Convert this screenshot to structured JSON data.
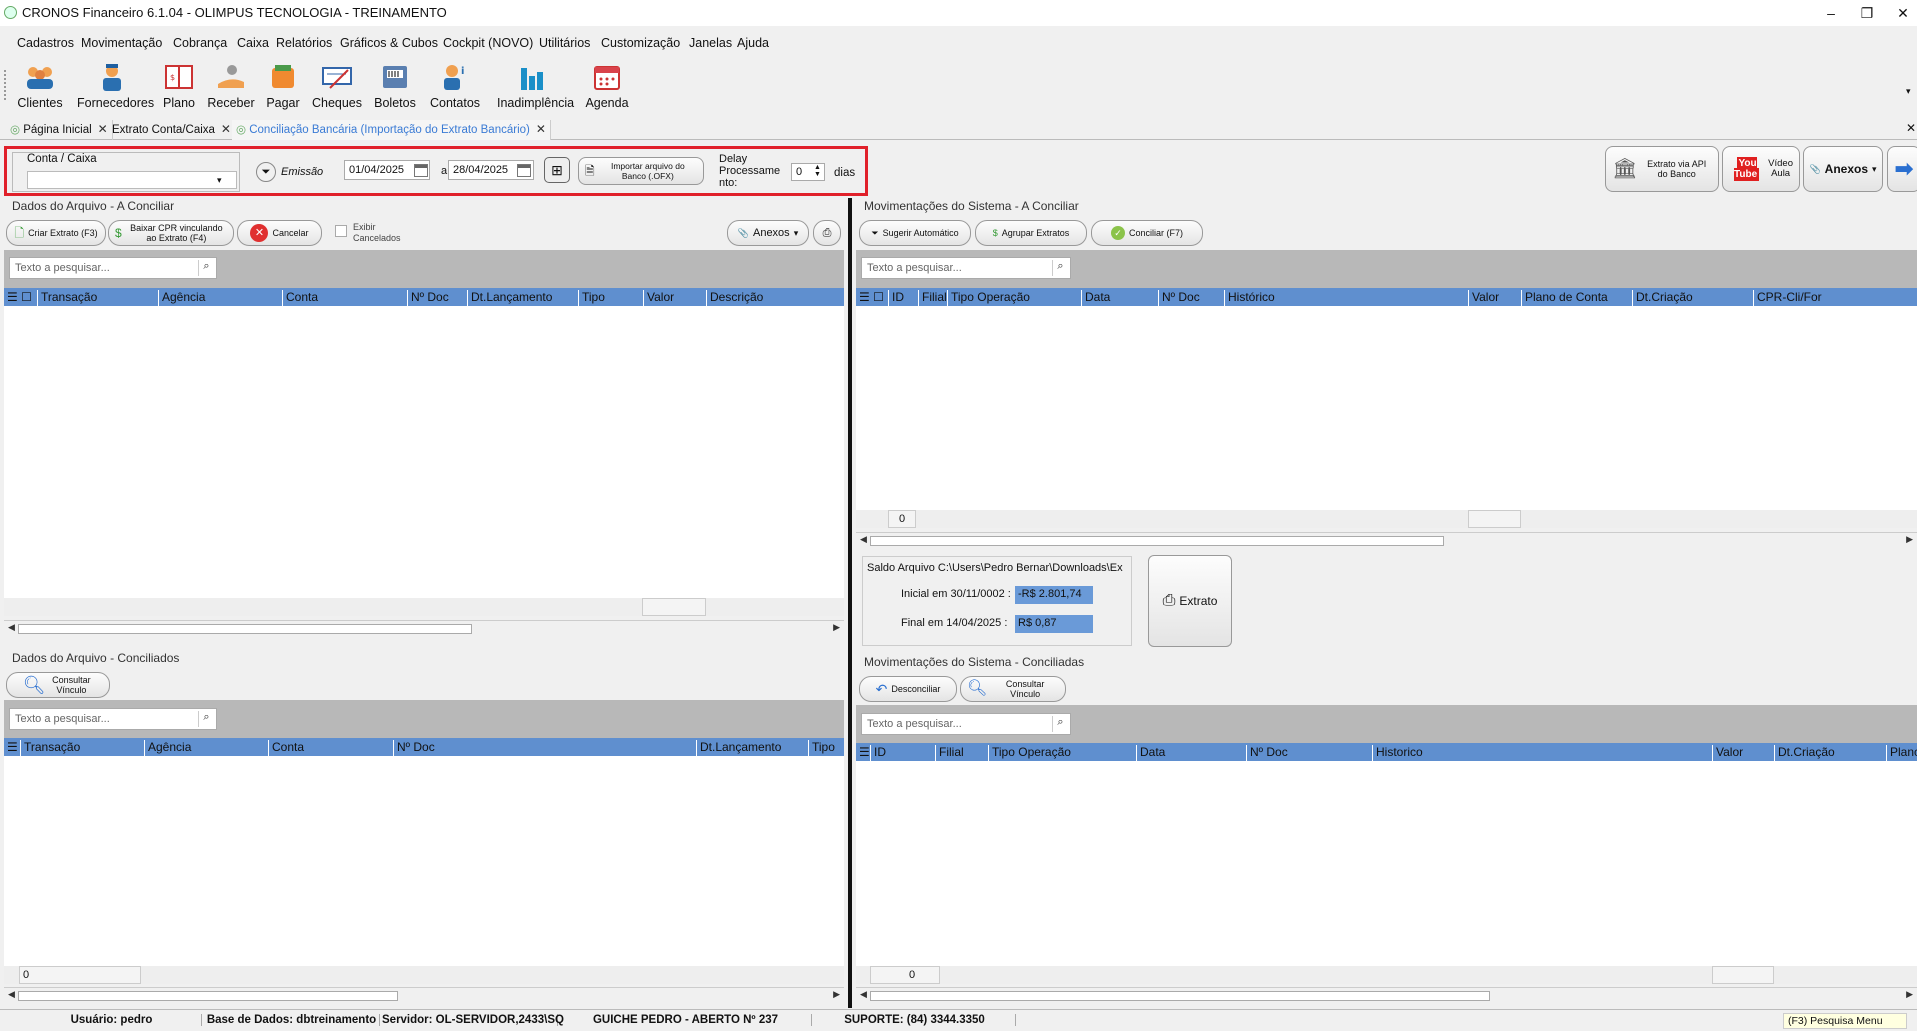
{
  "window": {
    "title": "CRONOS Financeiro 6.1.04 - OLIMPUS TECNOLOGIA - TREINAMENTO",
    "minimize": "‒",
    "restore": "❐",
    "close": "✕"
  },
  "menu": [
    "Cadastros",
    "Movimentação",
    "Cobrança",
    "Caixa",
    "Relatórios",
    "Gráficos & Cubos",
    "Cockpit (NOVO)",
    "Utilitários",
    "Customização",
    "Janelas",
    "Ajuda"
  ],
  "toolbar": [
    "Clientes",
    "Fornecedores",
    "Plano",
    "Receber",
    "Pagar",
    "Cheques",
    "Boletos",
    "Contatos",
    "Inadimplência",
    "Agenda"
  ],
  "tabs": [
    {
      "label": "Página Inicial"
    },
    {
      "label": "Extrato Conta/Caixa"
    },
    {
      "label": "Conciliação Bancária (Importação do Extrato Bancário)"
    }
  ],
  "filters": {
    "conta_label": "Conta / Caixa",
    "conta_value": "",
    "emissao_label": "Emissão",
    "date_from": "01/04/2025",
    "date_sep": "a",
    "date_to": "28/04/2025",
    "import_label": "Importar arquivo do Banco (.OFX)",
    "delay_label": "Delay Processame nto:",
    "delay_value": "0",
    "dias": "dias",
    "api_label": "Extrato via API do Banco",
    "video_label": "Vídeo Aula",
    "youtube": "You Tube",
    "anexos": "Anexos"
  },
  "left_top": {
    "title": "Dados do Arquivo - A Conciliar",
    "btn_criar": "Criar Extrato (F3)",
    "btn_baixar": "Baixar CPR vinculando ao Extrato (F4)",
    "btn_cancelar": "Cancelar",
    "chk_exibir": "Exibir Cancelados",
    "btn_anexos": "Anexos",
    "search_placeholder": "Texto a pesquisar...",
    "columns": [
      "Transação",
      "Agência",
      "Conta",
      "Nº Doc",
      "Dt.Lançamento",
      "Tipo",
      "Valor",
      "Descrição"
    ]
  },
  "left_bottom": {
    "title": "Dados do Arquivo - Conciliados",
    "btn_consultar": "Consultar Vínculo",
    "search_placeholder": "Texto a pesquisar...",
    "columns": [
      "Transação",
      "Agência",
      "Conta",
      "Nº Doc",
      "Dt.Lançamento",
      "Tipo"
    ],
    "count": "0"
  },
  "right_top": {
    "title": "Movimentações do Sistema - A Conciliar",
    "btn_sugerir": "Sugerir Automático",
    "btn_agrupar": "Agrupar Extratos",
    "btn_conciliar": "Conciliar (F7)",
    "search_placeholder": "Texto a pesquisar...",
    "columns": [
      "ID",
      "Filial",
      "Tipo Operação",
      "Data",
      "Nº Doc",
      "Histórico",
      "Valor",
      "Plano de Conta",
      "Dt.Criação",
      "CPR-Cli/For"
    ],
    "count": "0"
  },
  "saldo": {
    "path": "Saldo Arquivo C:\\Users\\Pedro Bernar\\Downloads\\Ex",
    "inicial_label": "Inicial em 30/11/0002 :",
    "inicial_value": "-R$ 2.801,74",
    "final_label": "Final em 14/04/2025 :",
    "final_value": "R$ 0,87",
    "extrato_btn": "Extrato"
  },
  "right_bottom": {
    "title": "Movimentações do Sistema - Conciliadas",
    "btn_desconciliar": "Desconciliar",
    "btn_consultar": "Consultar Vínculo",
    "search_placeholder": "Texto a pesquisar...",
    "columns": [
      "ID",
      "Filial",
      "Tipo Operação",
      "Data",
      "Nº Doc",
      "Historico",
      "Valor",
      "Dt.Criação",
      "Planc"
    ],
    "count": "0"
  },
  "status": {
    "usuario": "Usuário: pedro",
    "base": "Base de Dados: dbtreinamento",
    "servidor": "Servidor: OL-SERVIDOR,2433\\SQ",
    "guiche": "GUICHE PEDRO - ABERTO Nº 237",
    "suporte": "SUPORTE: (84) 3344.3350",
    "hint": "(F3) Pesquisa Menu"
  }
}
